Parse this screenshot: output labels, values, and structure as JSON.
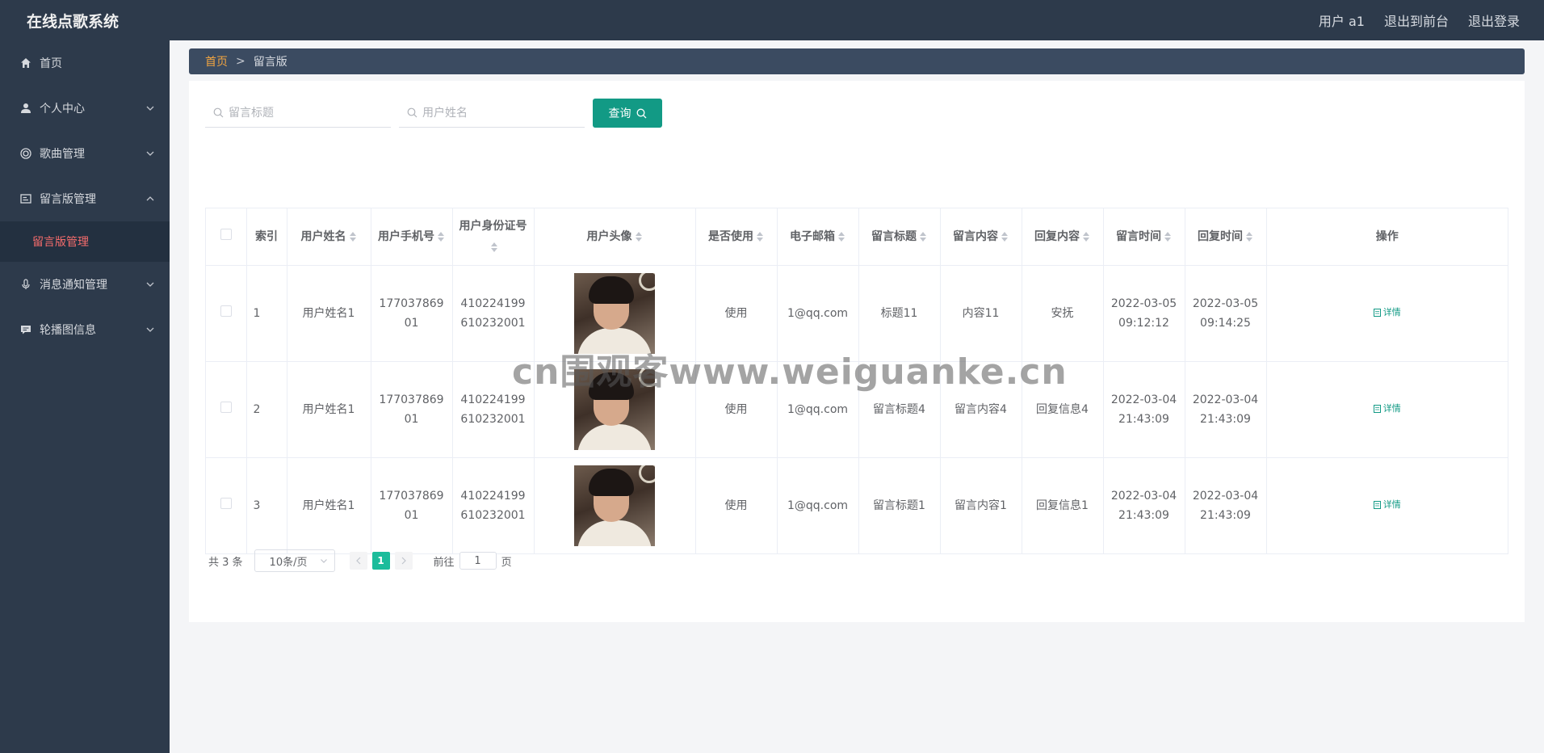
{
  "app": {
    "title": "在线点歌系统"
  },
  "header": {
    "user_label": "用户 a1",
    "front_label": "退出到前台",
    "logout_label": "退出登录"
  },
  "sidebar": {
    "items": [
      {
        "label": "首页",
        "icon": "home-icon"
      },
      {
        "label": "个人中心",
        "icon": "user-icon"
      },
      {
        "label": "歌曲管理",
        "icon": "music-icon"
      },
      {
        "label": "留言版管理",
        "icon": "message-board-icon"
      },
      {
        "label": "消息通知管理",
        "icon": "microphone-icon"
      },
      {
        "label": "轮播图信息",
        "icon": "comment-icon"
      }
    ],
    "active_sub": "留言版管理"
  },
  "breadcrumb": {
    "home": "首页",
    "separator": ">",
    "current": "留言版"
  },
  "search": {
    "title_placeholder": "留言标题",
    "name_placeholder": "用户姓名",
    "query_label": "查询"
  },
  "table": {
    "headers": {
      "index": "索引",
      "name": "用户姓名",
      "phone": "用户手机号",
      "idcard": "用户身份证号",
      "avatar": "用户头像",
      "used": "是否使用",
      "email": "电子邮箱",
      "title": "留言标题",
      "content": "留言内容",
      "reply": "回复内容",
      "time": "留言时间",
      "reply_time": "回复时间",
      "ops": "操作"
    },
    "rows": [
      {
        "index": "1",
        "name": "用户姓名1",
        "phone": "17703786901",
        "idcard": "410224199610232001",
        "used": "使用",
        "email": "1@qq.com",
        "title": "标题11",
        "content": "内容11",
        "reply": "安抚",
        "time": "2022-03-05 09:12:12",
        "reply_time": "2022-03-05 09:14:25",
        "op": "详情"
      },
      {
        "index": "2",
        "name": "用户姓名1",
        "phone": "17703786901",
        "idcard": "410224199610232001",
        "used": "使用",
        "email": "1@qq.com",
        "title": "留言标题4",
        "content": "留言内容4",
        "reply": "回复信息4",
        "time": "2022-03-04 21:43:09",
        "reply_time": "2022-03-04 21:43:09",
        "op": "详情"
      },
      {
        "index": "3",
        "name": "用户姓名1",
        "phone": "17703786901",
        "idcard": "410224199610232001",
        "used": "使用",
        "email": "1@qq.com",
        "title": "留言标题1",
        "content": "留言内容1",
        "reply": "回复信息1",
        "time": "2022-03-04 21:43:09",
        "reply_time": "2022-03-04 21:43:09",
        "op": "详情"
      }
    ]
  },
  "pager": {
    "total": "共 3 条",
    "size": "10条/页",
    "page": "1",
    "goto_prefix": "前往",
    "goto_value": "1",
    "goto_suffix": "页"
  },
  "watermark": "cn围观客www.weiguanke.cn",
  "colors": {
    "topbar": "#2d3a4b",
    "accent": "#129a85",
    "active_menu": "#f56c6c",
    "breadcrumb_home": "#f0a441"
  }
}
